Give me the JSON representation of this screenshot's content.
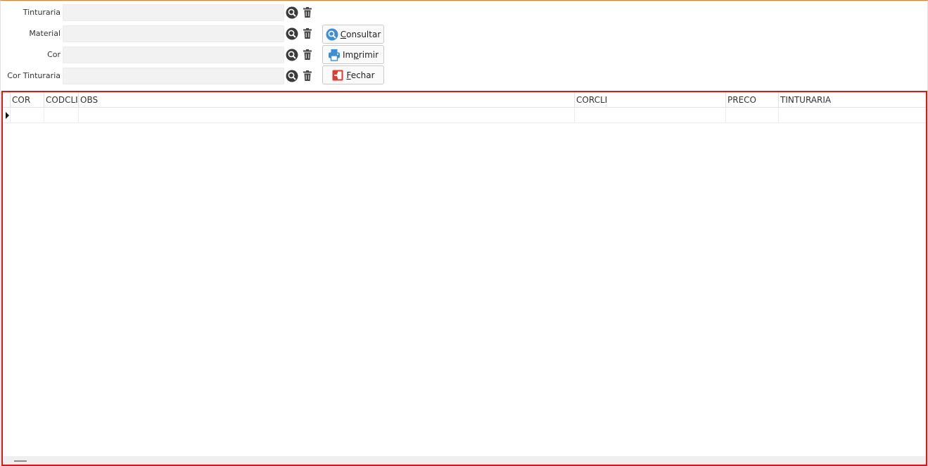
{
  "filters": {
    "tinturaria": {
      "label": "Tinturaria",
      "value": ""
    },
    "material": {
      "label": "Material",
      "value": ""
    },
    "cor": {
      "label": "Cor",
      "value": ""
    },
    "cor_tinturaria": {
      "label": "Cor Tinturaria",
      "value": ""
    }
  },
  "actions": {
    "consultar": {
      "mnemonic": "C",
      "rest": "onsultar",
      "icon": "search-icon"
    },
    "imprimir": {
      "pre": "Im",
      "mnemonic": "p",
      "rest": "rimir",
      "icon": "printer-icon"
    },
    "fechar": {
      "mnemonic": "F",
      "rest": "echar",
      "icon": "exit-icon"
    }
  },
  "grid": {
    "columns": [
      "COR",
      "CODCLI",
      "OBS",
      "CORCLI",
      "PRECO",
      "TINTURARIA"
    ]
  },
  "colors": {
    "accent_border": "#e8772e",
    "grid_highlight": "#e01515",
    "search_blue": "#3a8fd8",
    "exit_red": "#e23a2e"
  }
}
